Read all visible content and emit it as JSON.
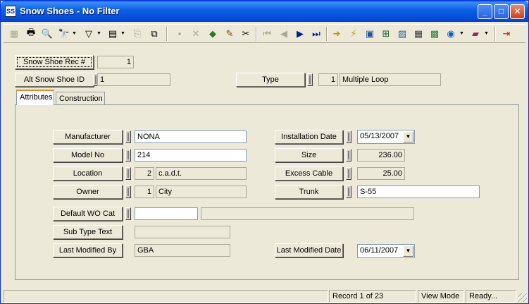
{
  "window": {
    "title": "Snow Shoes - No Filter",
    "app_icon_text": "SS",
    "minimize": "_",
    "maximize": "□",
    "close": "✕"
  },
  "toolbar": {
    "tools": [
      {
        "name": "new-record",
        "glyph": "▦",
        "disabled": true
      },
      {
        "name": "print",
        "glyph": "🖶",
        "disabled": false
      },
      {
        "name": "print-preview",
        "glyph": "🔍",
        "disabled": false
      },
      {
        "name": "find",
        "glyph": "🔭",
        "disabled": false
      },
      {
        "name": "filter",
        "glyph": "▽",
        "disabled": false
      },
      {
        "name": "report",
        "glyph": "▤",
        "disabled": false
      },
      {
        "name": "copy-record",
        "glyph": "⎘",
        "disabled": true
      },
      {
        "name": "paste-record",
        "glyph": "⧉",
        "disabled": false
      },
      {
        "name": "save",
        "glyph": "▪",
        "disabled": true
      },
      {
        "name": "delete",
        "glyph": "✕",
        "disabled": true
      },
      {
        "name": "layers",
        "glyph": "◆",
        "disabled": false
      },
      {
        "name": "edit",
        "glyph": "✎",
        "disabled": false
      },
      {
        "name": "cut",
        "glyph": "✂",
        "disabled": false
      },
      {
        "name": "first-record",
        "glyph": "⏮",
        "disabled": true
      },
      {
        "name": "previous-record",
        "glyph": "◀",
        "disabled": true
      },
      {
        "name": "next-record",
        "glyph": "▶",
        "disabled": false
      },
      {
        "name": "last-record",
        "glyph": "⏭",
        "disabled": false
      },
      {
        "name": "goto",
        "glyph": "➜",
        "disabled": false
      },
      {
        "name": "lightning",
        "glyph": "⚡",
        "disabled": false
      },
      {
        "name": "map",
        "glyph": "▣",
        "disabled": false
      },
      {
        "name": "hierarchy",
        "glyph": "⊞",
        "disabled": false
      },
      {
        "name": "chart",
        "glyph": "▨",
        "disabled": false
      },
      {
        "name": "calculator",
        "glyph": "▦",
        "disabled": false
      },
      {
        "name": "gis",
        "glyph": "▩",
        "disabled": false
      },
      {
        "name": "globe",
        "glyph": "◉",
        "disabled": false
      },
      {
        "name": "book",
        "glyph": "▰",
        "disabled": false
      },
      {
        "name": "exit",
        "glyph": "⇥",
        "disabled": false
      }
    ]
  },
  "header": {
    "rec_label": "Snow Shoe Rec #",
    "rec_value": "1",
    "alt_id_label": "Alt Snow Shoe ID",
    "alt_id_value": "1",
    "type_label": "Type",
    "type_code": "1",
    "type_value": "Multiple Loop"
  },
  "tabs": [
    "Attributes",
    "Construction"
  ],
  "attributes": {
    "manufacturer_label": "Manufacturer",
    "manufacturer_value": "NONA",
    "model_label": "Model No",
    "model_value": "214",
    "location_label": "Location",
    "location_code": "2",
    "location_value": "c.a.d.t.",
    "owner_label": "Owner",
    "owner_code": "1",
    "owner_value": "City",
    "default_wo_label": "Default WO Cat",
    "default_wo_code": "",
    "default_wo_value": "",
    "subtype_label": "Sub Type Text",
    "subtype_value": "",
    "last_modified_by_label": "Last Modified By",
    "last_modified_by_value": "GBA",
    "installation_date_label": "Installation Date",
    "installation_date_value": "05/13/2007",
    "size_label": "Size",
    "size_value": "236.00",
    "excess_cable_label": "Excess Cable",
    "excess_cable_value": "25.00",
    "trunk_label": "Trunk",
    "trunk_value": "S-55",
    "last_modified_date_label": "Last Modified Date",
    "last_modified_date_value": "06/11/2007"
  },
  "status": {
    "record": "Record 1 of 23",
    "mode": "View Mode",
    "state": "Ready..."
  }
}
